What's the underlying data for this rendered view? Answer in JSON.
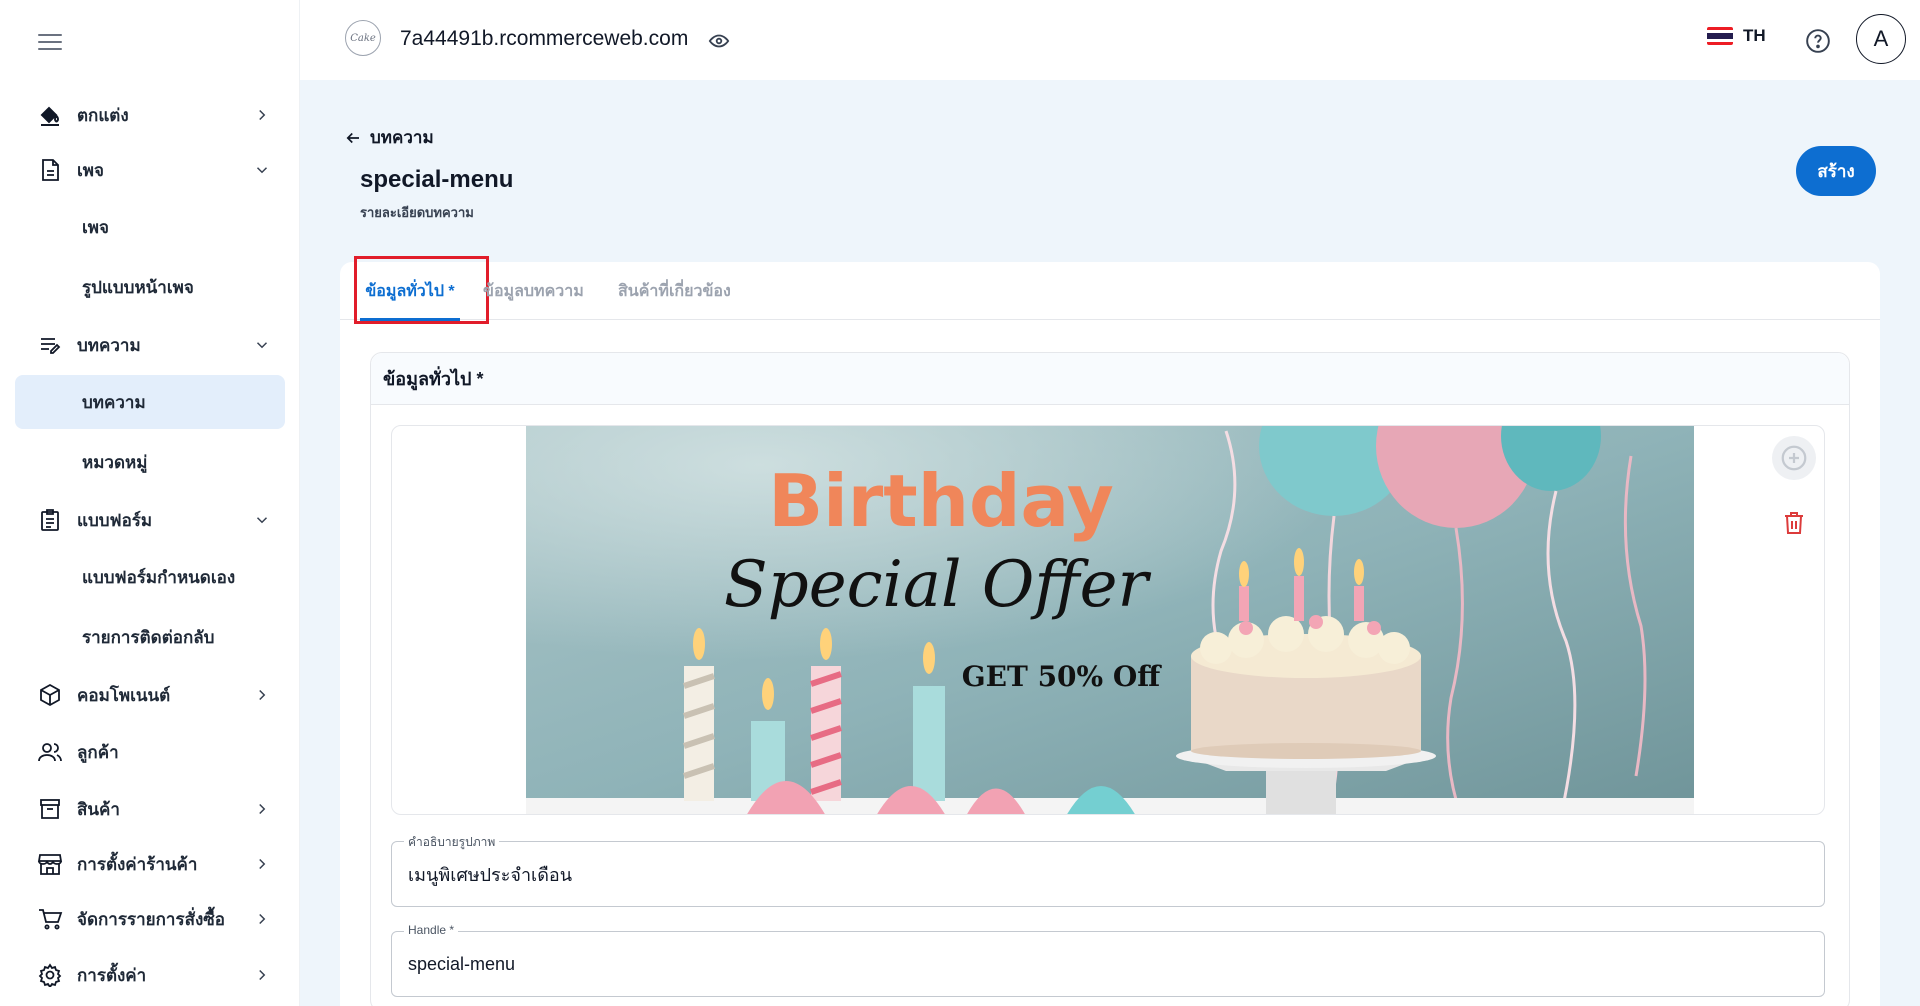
{
  "sidebar": {
    "items": [
      {
        "label": "ตกแต่ง"
      },
      {
        "label": "เพจ"
      },
      {
        "label": "เพจ"
      },
      {
        "label": "รูปแบบหน้าเพจ"
      },
      {
        "label": "บทความ"
      },
      {
        "label": "บทความ"
      },
      {
        "label": "หมวดหมู่"
      },
      {
        "label": "แบบฟอร์ม"
      },
      {
        "label": "แบบฟอร์มกำหนดเอง"
      },
      {
        "label": "รายการติดต่อกลับ"
      },
      {
        "label": "คอมโพเนนต์"
      },
      {
        "label": "ลูกค้า"
      },
      {
        "label": "สินค้า"
      },
      {
        "label": "การตั้งค่าร้านค้า"
      },
      {
        "label": "จัดการรายการสั่งซื้อ"
      },
      {
        "label": "การตั้งค่า"
      }
    ]
  },
  "header": {
    "domain": "7a44491b.rcommerceweb.com",
    "language": "TH",
    "avatar_initial": "A",
    "flag_colors": [
      "#ed1c24",
      "#ffffff",
      "#241d4f",
      "#ffffff",
      "#ed1c24"
    ]
  },
  "page": {
    "back_label": "บทความ",
    "title": "special-menu",
    "subtitle": "รายละเอียดบทความ",
    "create_label": "สร้าง"
  },
  "tabs": [
    {
      "label": "ข้อมูลทั่วไป *",
      "active": true
    },
    {
      "label": "ข้อมูลบทความ",
      "active": false
    },
    {
      "label": "สินค้าที่เกี่ยวข้อง",
      "active": false
    }
  ],
  "section": {
    "title": "ข้อมูลทั่วไป *"
  },
  "banner": {
    "headline": "Birthday",
    "script": "Special Offer",
    "offer": "GET 50% Off"
  },
  "fields": {
    "caption": {
      "label": "คำอธิบายรูปภาพ",
      "value": "เมนูพิเศษประจำเดือน"
    },
    "handle": {
      "label": "Handle *",
      "value": "special-menu"
    }
  },
  "colors": {
    "primary": "#0d6ed1",
    "active_bg": "#e3eefb",
    "main_bg": "#eef5fb",
    "highlight": "#e11d2a",
    "danger": "#dc3b3b"
  }
}
